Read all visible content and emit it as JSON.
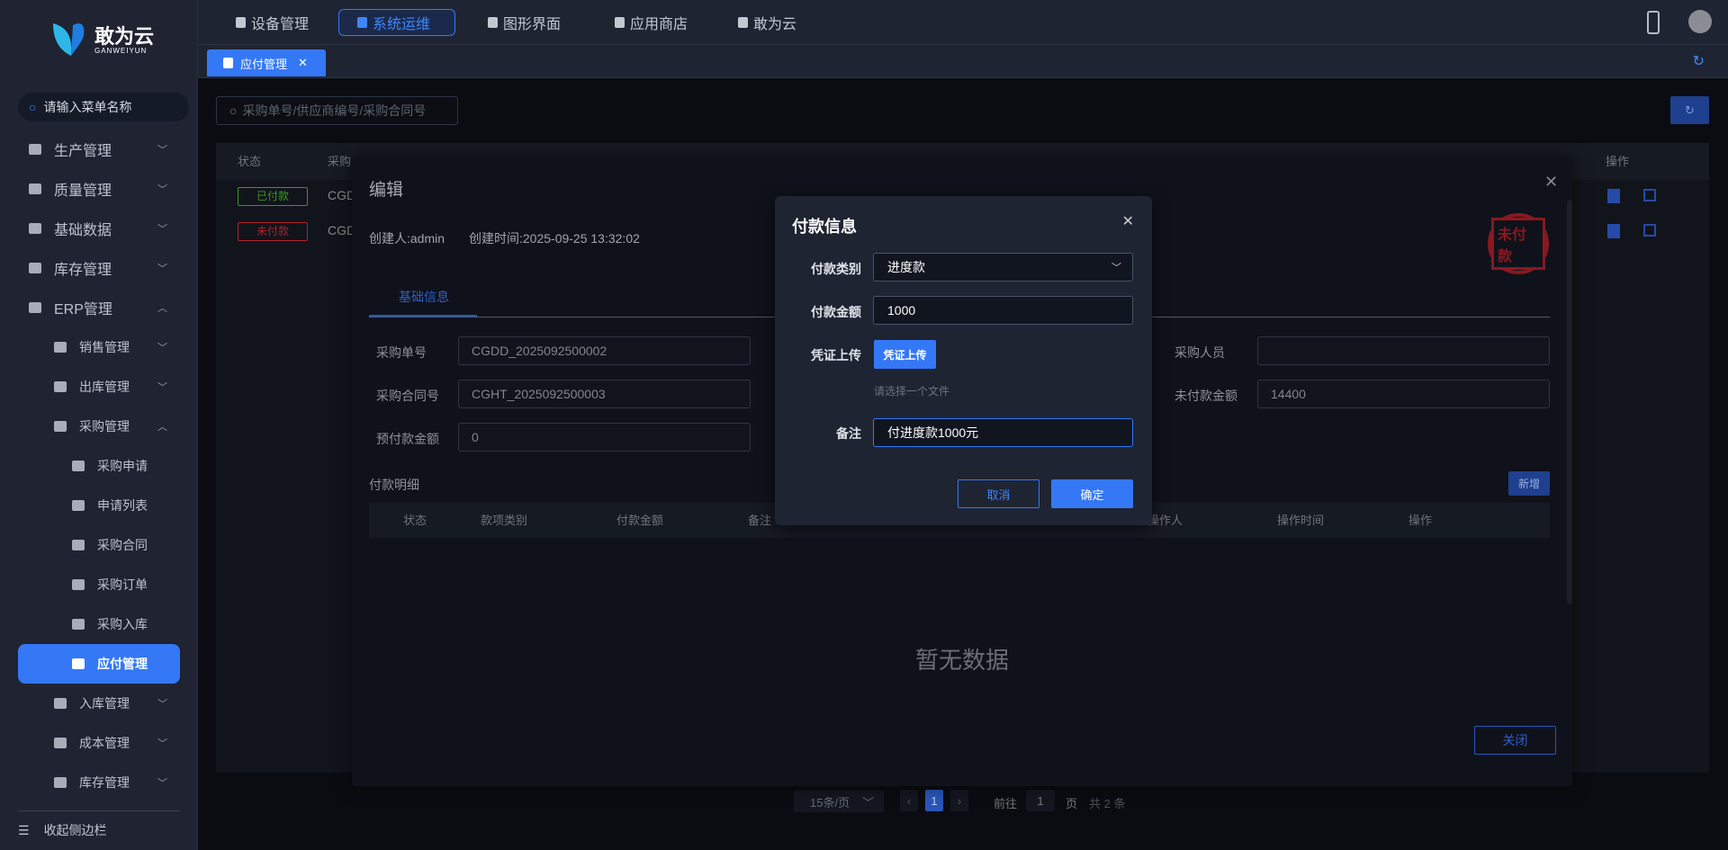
{
  "logo": {
    "name": "敢为云",
    "sub": "GANWEIYUN"
  },
  "sidebar": {
    "search_placeholder": "请输入菜单名称",
    "collapse": "收起侧边栏",
    "items": [
      {
        "label": "生产管理",
        "chev": "﹀"
      },
      {
        "label": "质量管理",
        "chev": "﹀"
      },
      {
        "label": "基础数据",
        "chev": "﹀"
      },
      {
        "label": "库存管理",
        "chev": "﹀"
      },
      {
        "label": "ERP管理",
        "chev": "︿"
      },
      {
        "label": "销售管理",
        "chev": "﹀"
      },
      {
        "label": "出库管理",
        "chev": "﹀"
      },
      {
        "label": "采购管理",
        "chev": "︿"
      },
      {
        "label": "采购申请"
      },
      {
        "label": "申请列表"
      },
      {
        "label": "采购合同"
      },
      {
        "label": "采购订单"
      },
      {
        "label": "采购入库"
      },
      {
        "label": "应付管理"
      },
      {
        "label": "入库管理",
        "chev": "﹀"
      },
      {
        "label": "成本管理",
        "chev": "﹀"
      },
      {
        "label": "库存管理",
        "chev": "﹀"
      }
    ]
  },
  "topnav": [
    "设备管理",
    "系统运维",
    "图形界面",
    "应用商店",
    "敢为云"
  ],
  "tab": {
    "label": "应付管理",
    "close": "✕"
  },
  "search": {
    "placeholder": "采购单号/供应商编号/采购合同号"
  },
  "table": {
    "headers": [
      "状态",
      "采购",
      "操作"
    ],
    "rows": [
      {
        "status": "已付款",
        "code": "CGD"
      },
      {
        "status": "未付款",
        "code": "CGD"
      }
    ]
  },
  "pagination": {
    "page_size": "15条/页",
    "current": "1",
    "goto": "前往",
    "goto_value": "1",
    "page": "页",
    "total": "共 2 条"
  },
  "edit": {
    "title": "编辑",
    "creator": "创建人:admin",
    "created": "创建时间:2025-09-25 13:32:02",
    "stamp": "未付款",
    "tab": "基础信息",
    "fields": [
      {
        "label": "采购单号",
        "value": "CGDD_2025092500002"
      },
      {
        "label": "采购合同号",
        "value": "CGHT_2025092500003"
      },
      {
        "label": "预付款金额",
        "value": "0"
      },
      {
        "label": "采购人员",
        "value": ""
      },
      {
        "label": "未付款金额",
        "value": "14400"
      }
    ],
    "detail_title": "付款明细",
    "add": "新增",
    "detail_headers": [
      "状态",
      "款项类别",
      "付款金额",
      "备注",
      "操作人",
      "操作时间",
      "操作"
    ],
    "empty": "暂无数据",
    "close_btn": "关闭"
  },
  "pay": {
    "title": "付款信息",
    "type_label": "付款类别",
    "type_value": "进度款",
    "amount_label": "付款金额",
    "amount_value": "1000",
    "upload_label": "凭证上传",
    "upload_btn": "凭证上传",
    "upload_hint": "请选择一个文件",
    "note_label": "备注",
    "note_value": "付进度款1000元",
    "cancel": "取消",
    "ok": "确定"
  },
  "colors": {
    "accent": "#3478f6",
    "paid": "#3a9a1e",
    "unpaid": "#b0202a"
  }
}
